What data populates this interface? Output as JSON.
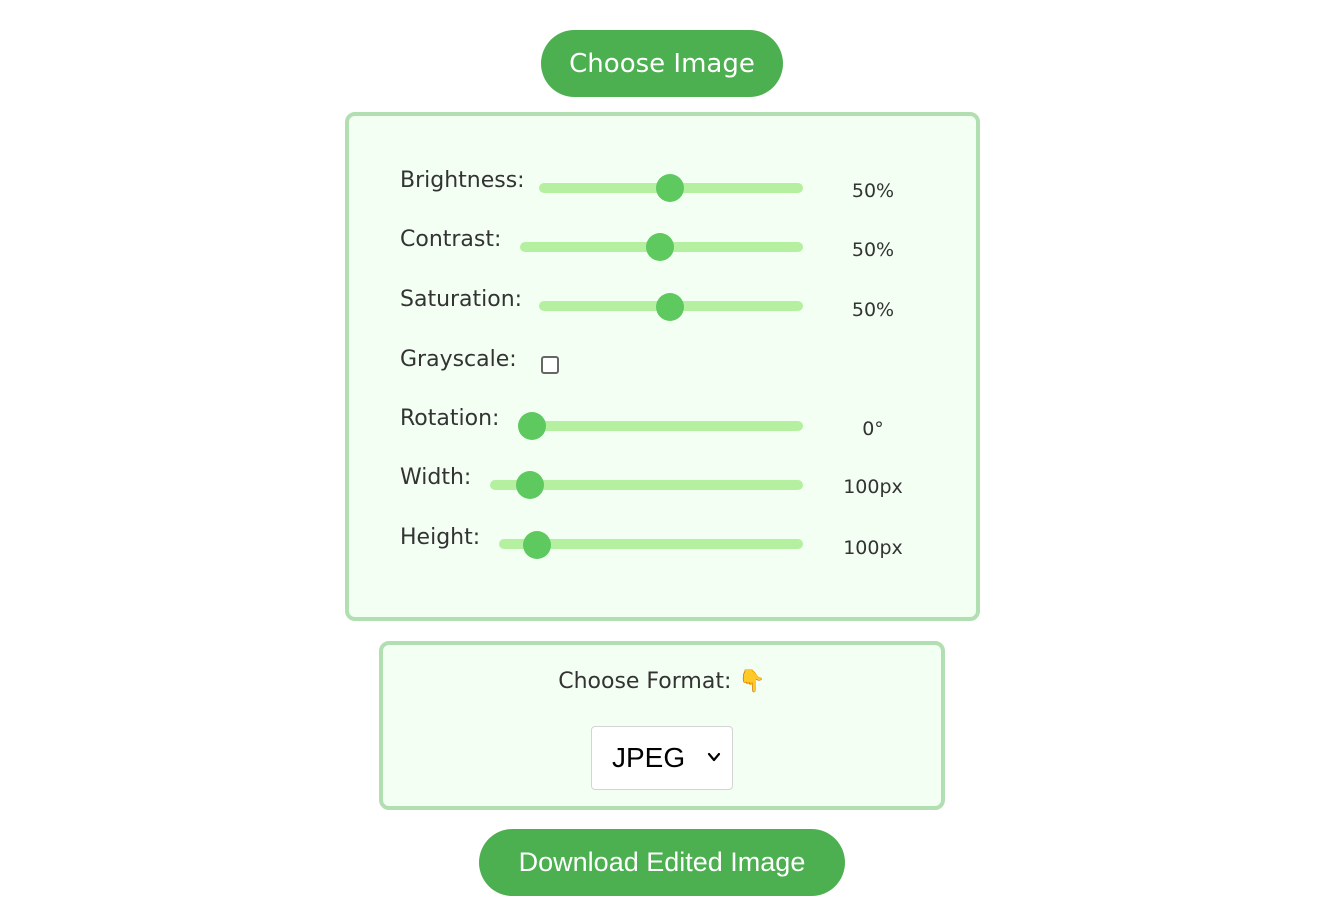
{
  "header": {
    "choose_image_label": "Choose Image"
  },
  "adjustments": {
    "brightness": {
      "label": "Brightness:",
      "value_text": "50%",
      "value": 0.5
    },
    "contrast": {
      "label": "Contrast:",
      "value_text": "50%",
      "value": 0.5
    },
    "saturation": {
      "label": "Saturation:",
      "value_text": "50%",
      "value": 0.5
    },
    "grayscale": {
      "label": "Grayscale:",
      "checked": false
    },
    "rotation": {
      "label": "Rotation:",
      "value_text": "0°",
      "value": 0.0
    },
    "width": {
      "label": "Width:",
      "value_text": "100px",
      "value": 0.04
    },
    "height": {
      "label": "Height:",
      "value_text": "100px",
      "value": 0.04
    }
  },
  "format": {
    "label": "Choose Format:",
    "hand_icon": "👇",
    "selected": "JPEG"
  },
  "footer": {
    "download_label": "Download Edited Image"
  },
  "colors": {
    "accent": "#4caf50",
    "track": "#b4f0a0",
    "thumb": "#5ec95e",
    "panel_bg": "#f3fff3",
    "panel_border": "#b2dfb2"
  }
}
